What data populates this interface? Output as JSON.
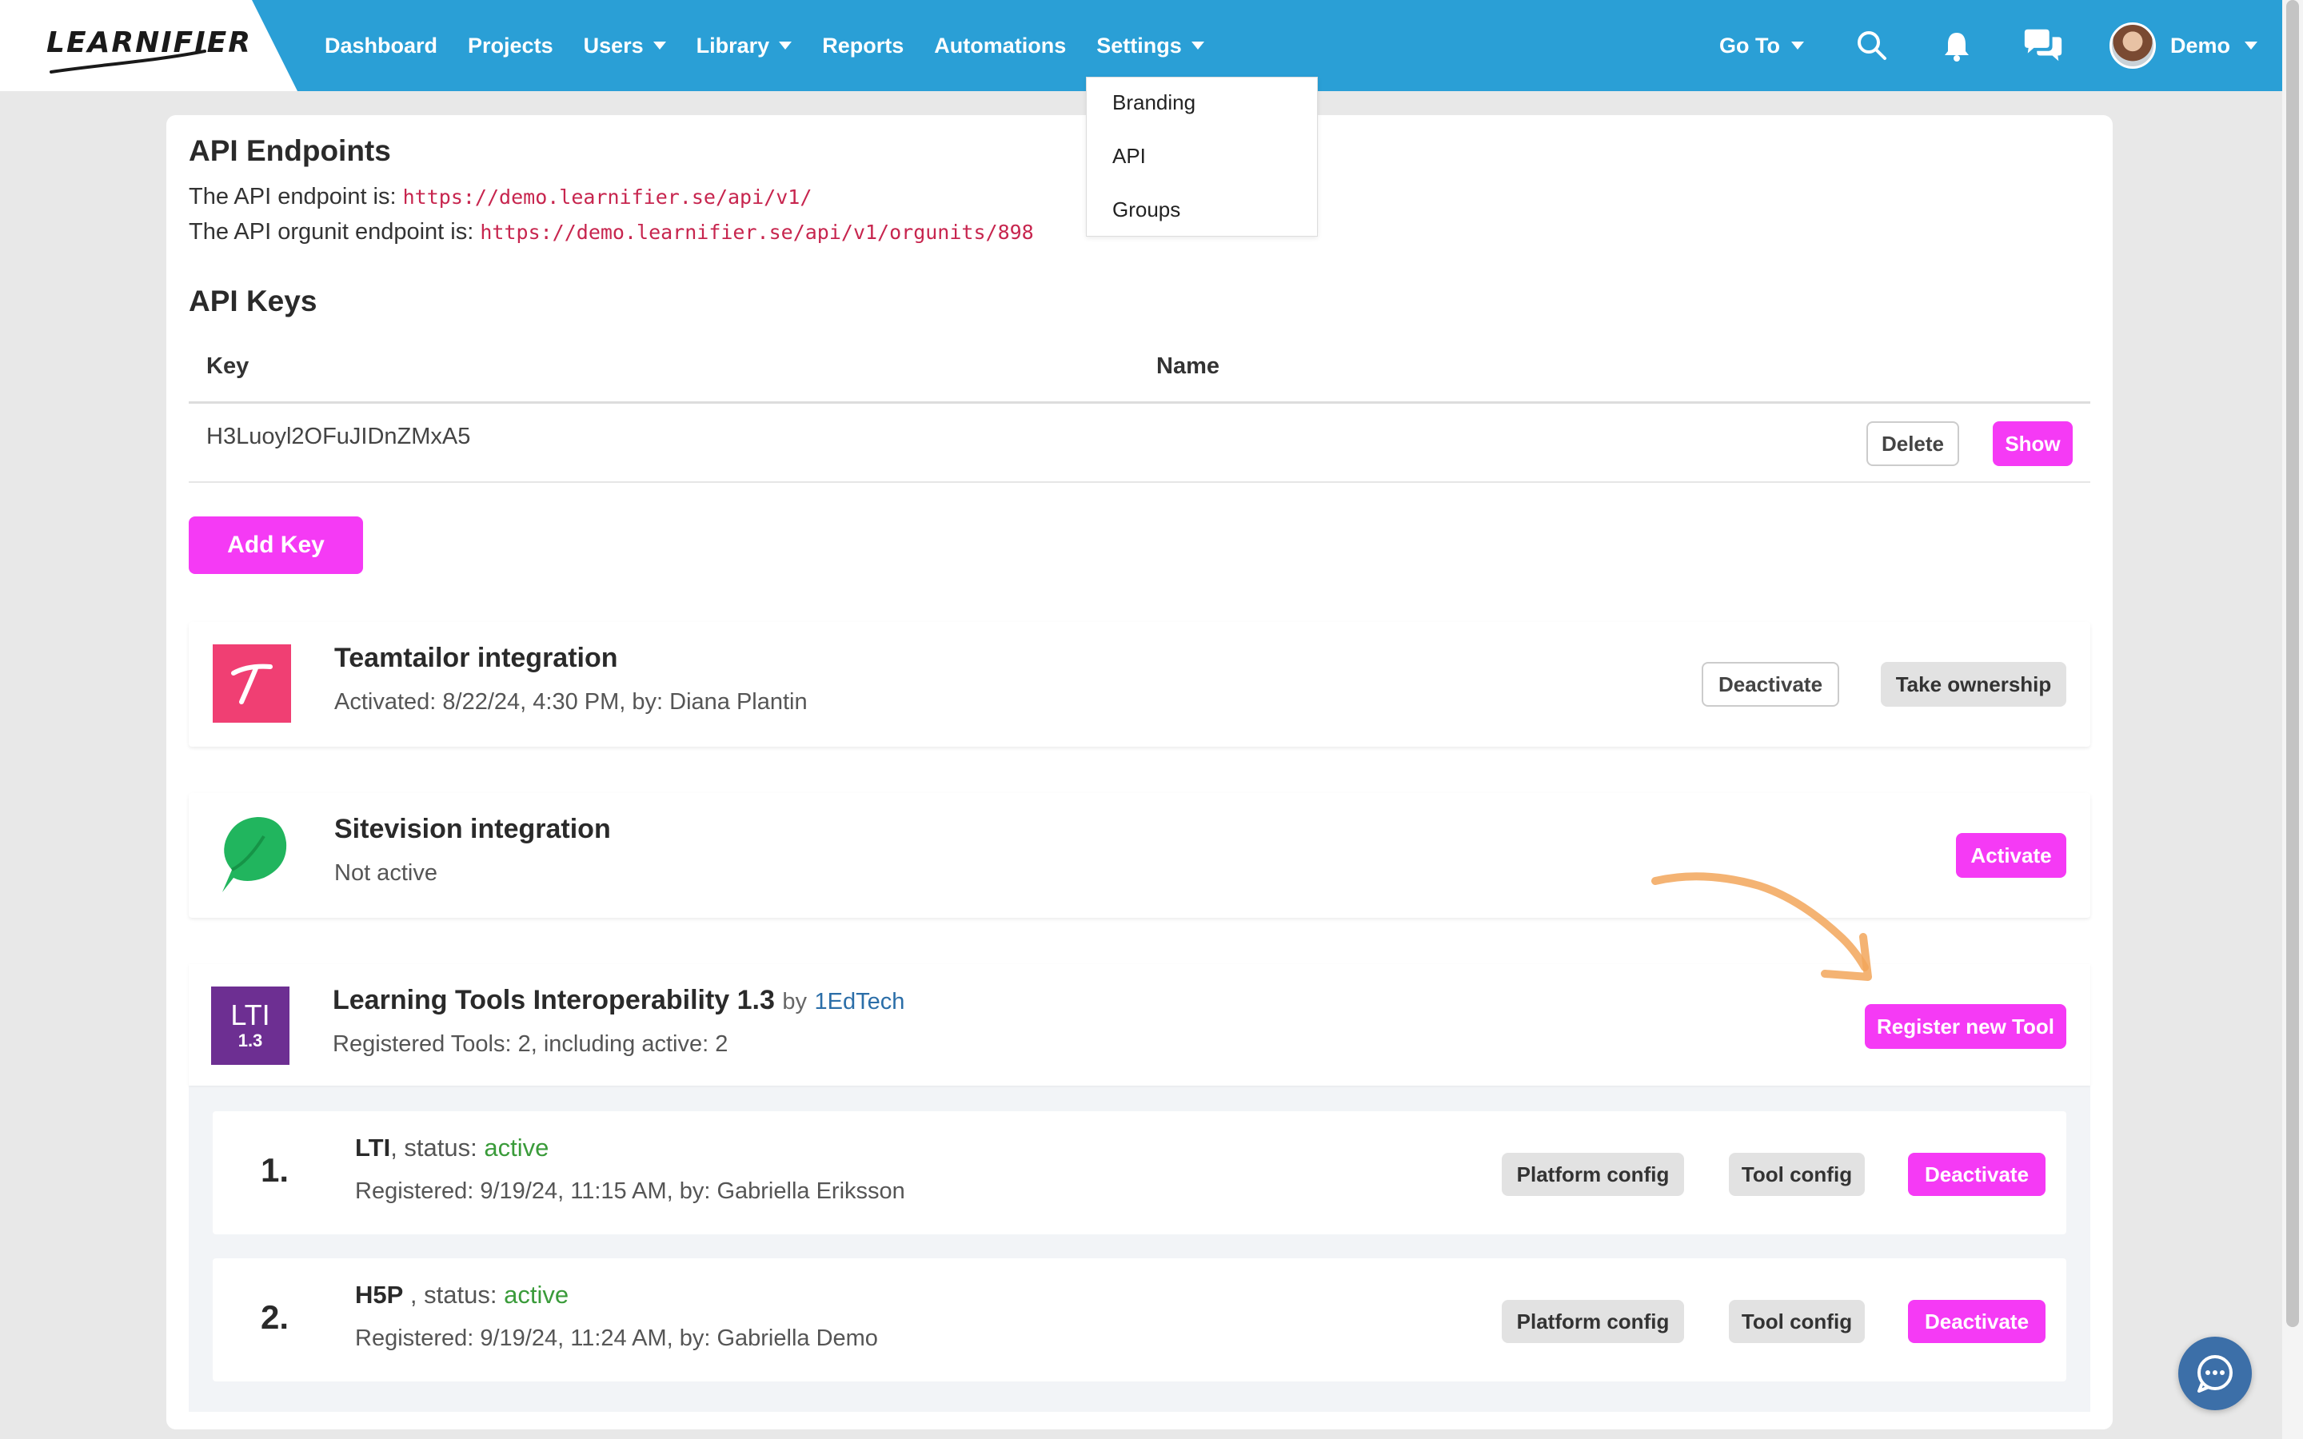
{
  "brand": {
    "logo_text": "LEARNIFIER",
    "nav_color": "#2a9fd6",
    "accent": "#f53af5"
  },
  "nav": {
    "items": [
      {
        "label": "Dashboard",
        "has_caret": false
      },
      {
        "label": "Projects",
        "has_caret": false
      },
      {
        "label": "Users",
        "has_caret": true
      },
      {
        "label": "Library",
        "has_caret": true
      },
      {
        "label": "Reports",
        "has_caret": false
      },
      {
        "label": "Automations",
        "has_caret": false
      },
      {
        "label": "Settings",
        "has_caret": true
      }
    ],
    "goto_label": "Go To",
    "user_name": "Demo"
  },
  "settings_menu": {
    "items": [
      "Branding",
      "API",
      "Groups"
    ]
  },
  "api": {
    "endpoints_heading": "API Endpoints",
    "endpoint_label": "The API endpoint is:",
    "endpoint_url": "https://demo.learnifier.se/api/v1/",
    "orgunit_label": "The API orgunit endpoint is:",
    "orgunit_url": "https://demo.learnifier.se/api/v1/orgunits/898",
    "keys_heading": "API Keys",
    "columns": [
      "Key",
      "Name"
    ],
    "keys": [
      {
        "key": "H3Luoyl2OFuJIDnZMxA5",
        "name": "",
        "delete_label": "Delete",
        "show_label": "Show"
      }
    ],
    "add_key_label": "Add Key"
  },
  "integrations": {
    "teamtailor": {
      "title": "Teamtailor integration",
      "status": "Activated: 8/22/24, 4:30 PM, by: Diana Plantin",
      "deactivate_label": "Deactivate",
      "ownership_label": "Take ownership"
    },
    "sitevision": {
      "title": "Sitevision integration",
      "status": "Not active",
      "activate_label": "Activate"
    },
    "lti": {
      "logo_top": "LTI",
      "logo_bottom": "1.3",
      "title": "Learning Tools Interoperability 1.3",
      "by": "by",
      "vendor": "1EdTech",
      "summary": "Registered Tools: 2, including active: 2",
      "register_label": "Register new Tool",
      "tools": [
        {
          "num": "1.",
          "name": "LTI",
          "status_prefix": ", status:",
          "status": "active",
          "registered": "Registered: 9/19/24, 11:15 AM, by: Gabriella Eriksson",
          "platform_label": "Platform config",
          "tool_label": "Tool config",
          "deactivate_label": "Deactivate"
        },
        {
          "num": "2.",
          "name": "H5P",
          "status_prefix": " , status:",
          "status": "active",
          "registered": "Registered: 9/19/24, 11:24 AM, by: Gabriella Demo",
          "platform_label": "Platform config",
          "tool_label": "Tool config",
          "deactivate_label": "Deactivate"
        }
      ]
    }
  },
  "icons": [
    "search-icon",
    "bell-icon",
    "chat-icon",
    "caret-down-icon",
    "chat-bubble-icon"
  ]
}
